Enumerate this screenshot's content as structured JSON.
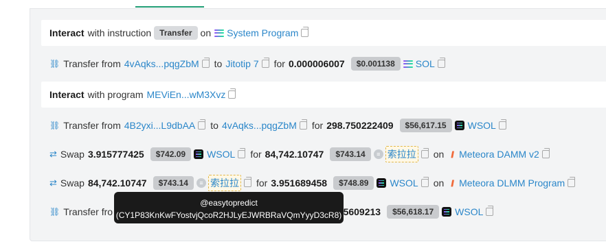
{
  "rows": [
    {
      "kind": "interact",
      "bold": "Interact",
      "text": "with instruction",
      "badge": "Transfer",
      "on": "on",
      "program": "System Program"
    },
    {
      "kind": "transfer",
      "text": "Transfer from",
      "from": "4vAqks...pqgZbM",
      "to_word": "to",
      "to": "Jitotip 7",
      "for_word": "for",
      "amount": "0.000006007",
      "usd": "$0.001138",
      "token": "SOL"
    },
    {
      "kind": "interact2",
      "bold": "Interact",
      "text": "with program",
      "program": "MEViEn...wM3Xvz"
    },
    {
      "kind": "transfer",
      "text": "Transfer from",
      "from": "4B2yxi...L9dbAA",
      "to_word": "to",
      "to": "4vAqks...pqgZbM",
      "for_word": "for",
      "amount": "298.750222409",
      "usd": "$56,617.15",
      "token": "WSOL"
    },
    {
      "kind": "swap",
      "text": "Swap",
      "amount_in": "3.915777425",
      "usd_in": "$742.09",
      "token_in": "WSOL",
      "for_word": "for",
      "amount_out": "84,742.10747",
      "usd_out": "$743.14",
      "token_out": "索拉拉",
      "on": "on",
      "venue": "Meteora DAMM v2"
    },
    {
      "kind": "swap",
      "text": "Swap",
      "amount_in": "84,742.10747",
      "usd_in": "$743.14",
      "token_in": "索拉拉",
      "for_word": "for",
      "amount_out": "3.951689458",
      "usd_out": "$748.89",
      "token_out": "WSOL",
      "on": "on",
      "venue": "Meteora DLMM Program"
    },
    {
      "kind": "transfer",
      "text": "Transfer fro",
      "amount_tail": "755609213",
      "usd": "$56,618.17",
      "token": "WSOL"
    }
  ],
  "tooltip": {
    "line1": "@easytopredict",
    "line2": "(CY1P83KnKwFYostvjQcoR2HJLyEJWRBRaVQmYyyD3cR8)"
  },
  "icons": {
    "transfer": "transfer-arrows-icon",
    "swap": "swap-arrows-icon",
    "copy": "copy-icon",
    "sol": "solana-logo-icon",
    "wsol": "wrapped-sol-icon",
    "meteora": "meteora-logo-icon"
  },
  "colors": {
    "link": "#2a86c9",
    "accent": "#1f9d74",
    "tooltip_bg": "#1a1a1a"
  }
}
